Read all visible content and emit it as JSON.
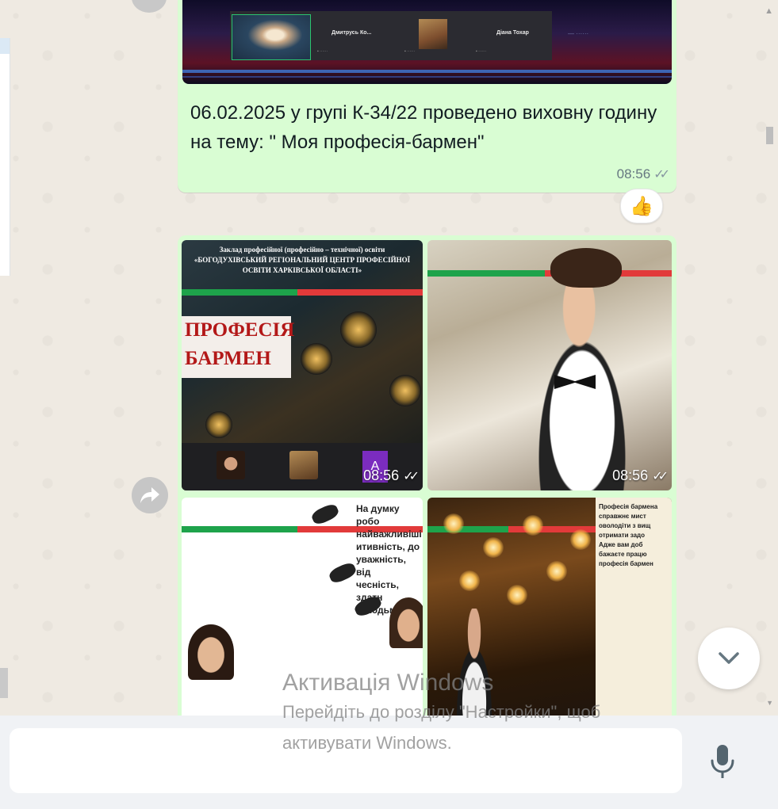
{
  "message": {
    "text": "06.02.2025 у групі К-34/22 проведено виховну годину на тему: \" Моя професія-бармен\"",
    "time": "08:56",
    "status": "read-double-check",
    "reaction": "👍"
  },
  "video_call_thumbnail": {
    "participant_names": [
      "Дмитрусь Ко...",
      "Діана Тохар"
    ]
  },
  "album": {
    "time": "08:56",
    "image1": {
      "header_lines": [
        "Заклад професійної (професійно – технічної) освіти",
        "«БОГОДУХІВСЬКИЙ РЕГІОНАЛЬНИЙ ЦЕНТР ПРОФЕСІЙНОЇ",
        "ОСВІТИ ХАРКІВСЬКОЇ ОБЛАСТІ»"
      ],
      "title_lines": [
        "ПРОФЕСІЯ",
        "БАРМЕН"
      ],
      "call_tile_letter": "А"
    },
    "image3": {
      "text_lines": [
        "На думку робо",
        "найважливіші",
        "итивність, до",
        "уважність, від",
        "чесність, здатн",
        "з людьми."
      ]
    },
    "image4": {
      "text_lines": [
        "Професія бармена",
        "справжнє мист",
        "оволодіти з вищ",
        "отримати задо",
        "Адже вам доб",
        "бажаєте працю",
        "професія бармен"
      ]
    }
  },
  "watermark": {
    "line1": "Активація Windows",
    "line2": "Перейдіть до розділу \"Настройки\", щоб",
    "line3": "активувати Windows."
  },
  "composer": {
    "placeholder": ""
  },
  "icons": {
    "forward": "forward-icon",
    "scroll_down": "chevron-down-icon",
    "mic": "microphone-icon"
  },
  "colors": {
    "outgoing_bubble": "#d9fdd3",
    "chat_background": "#efeae2",
    "composer_background": "#f0f2f5",
    "read_check": "#8696a0"
  }
}
